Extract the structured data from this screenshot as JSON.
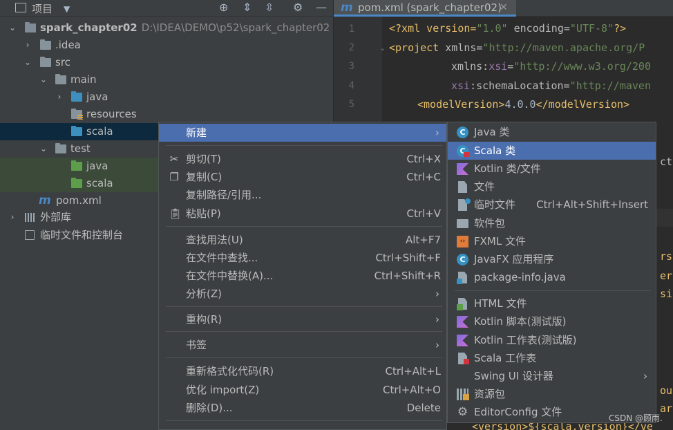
{
  "project_panel": {
    "title": "项目",
    "tree": [
      {
        "label": "spark_chapter02",
        "path": "D:\\IDEA\\DEMO\\p52\\spark_chapter02"
      },
      {
        "label": ".idea"
      },
      {
        "label": "src"
      },
      {
        "label": "main"
      },
      {
        "label": "java"
      },
      {
        "label": "resources"
      },
      {
        "label": "scala"
      },
      {
        "label": "test"
      },
      {
        "label": "java"
      },
      {
        "label": "scala"
      },
      {
        "label": "pom.xml"
      },
      {
        "label": "外部库"
      },
      {
        "label": "临时文件和控制台"
      }
    ]
  },
  "editor": {
    "tab_title": "pom.xml (spark_chapter02)",
    "line_numbers": [
      "1",
      "2",
      "3",
      "4",
      "5"
    ],
    "fragments": {
      "l1a": "<?xml version=",
      "l1b": "\"1.0\"",
      "l1c": " encoding=",
      "l1d": "\"UTF-8\"",
      "l1e": "?>",
      "l2a": "<project ",
      "l2b": "xmlns=",
      "l2c": "\"http://maven.apache.org/P",
      "l3a": "xmlns:",
      "l3b": "xsi",
      "l3c": "=",
      "l3d": "\"http://www.w3.org/200",
      "l4a": "xsi",
      "l4b": ":schemaLocation=",
      "l4c": "\"http://maven",
      "l5a": "<modelVersion>",
      "l5b": "4.0.0",
      "l5c": "</modelVersion>",
      "r1": "ct",
      "r2": "rs",
      "r3": "er",
      "r4": "si",
      "r5": "ou",
      "r6": "ar",
      "r7": "<version>${scala.version}</ve"
    }
  },
  "context_menu": {
    "new": "新建",
    "cut": "剪切(T)",
    "cut_sc": "Ctrl+X",
    "copy": "复制(C)",
    "copy_sc": "Ctrl+C",
    "copy_path": "复制路径/引用...",
    "paste": "粘贴(P)",
    "paste_sc": "Ctrl+V",
    "find_usages": "查找用法(U)",
    "find_usages_sc": "Alt+F7",
    "find_in_files": "在文件中查找...",
    "find_in_files_sc": "Ctrl+Shift+F",
    "replace_in_files": "在文件中替换(A)...",
    "replace_in_files_sc": "Ctrl+Shift+R",
    "analyze": "分析(Z)",
    "refactor": "重构(R)",
    "bookmarks": "书签",
    "reformat": "重新格式化代码(R)",
    "reformat_sc": "Ctrl+Alt+L",
    "optimize_imports": "优化 import(Z)",
    "optimize_imports_sc": "Ctrl+Alt+O",
    "delete": "删除(D)...",
    "delete_sc": "Delete",
    "submenu_arrow": "›"
  },
  "submenu": {
    "items": [
      {
        "label": "Java 类",
        "icon": "java-class-icon"
      },
      {
        "label": "Scala 类",
        "icon": "scala-class-icon"
      },
      {
        "label": "Kotlin 类/文件",
        "icon": "kotlin-icon"
      },
      {
        "label": "文件",
        "icon": "file-icon"
      },
      {
        "label": "临时文件",
        "icon": "scratch-file-icon",
        "shortcut": "Ctrl+Alt+Shift+Insert"
      },
      {
        "label": "软件包",
        "icon": "package-icon"
      },
      {
        "label": "FXML 文件",
        "icon": "fxml-icon"
      },
      {
        "label": "JavaFX 应用程序",
        "icon": "javafx-icon"
      },
      {
        "label": "package-info.java",
        "icon": "package-info-icon"
      },
      {
        "label": "HTML 文件",
        "icon": "html-icon"
      },
      {
        "label": "Kotlin 脚本(测试版)",
        "icon": "kotlin-script-icon"
      },
      {
        "label": "Kotlin 工作表(测试版)",
        "icon": "kotlin-worksheet-icon"
      },
      {
        "label": "Scala 工作表",
        "icon": "scala-worksheet-icon"
      },
      {
        "label": "Swing UI 设计器",
        "icon": "swing-icon"
      },
      {
        "label": "资源包",
        "icon": "resource-bundle-icon"
      },
      {
        "label": "EditorConfig 文件",
        "icon": "gear-icon"
      }
    ]
  },
  "watermark": "CSDN @顾雨."
}
